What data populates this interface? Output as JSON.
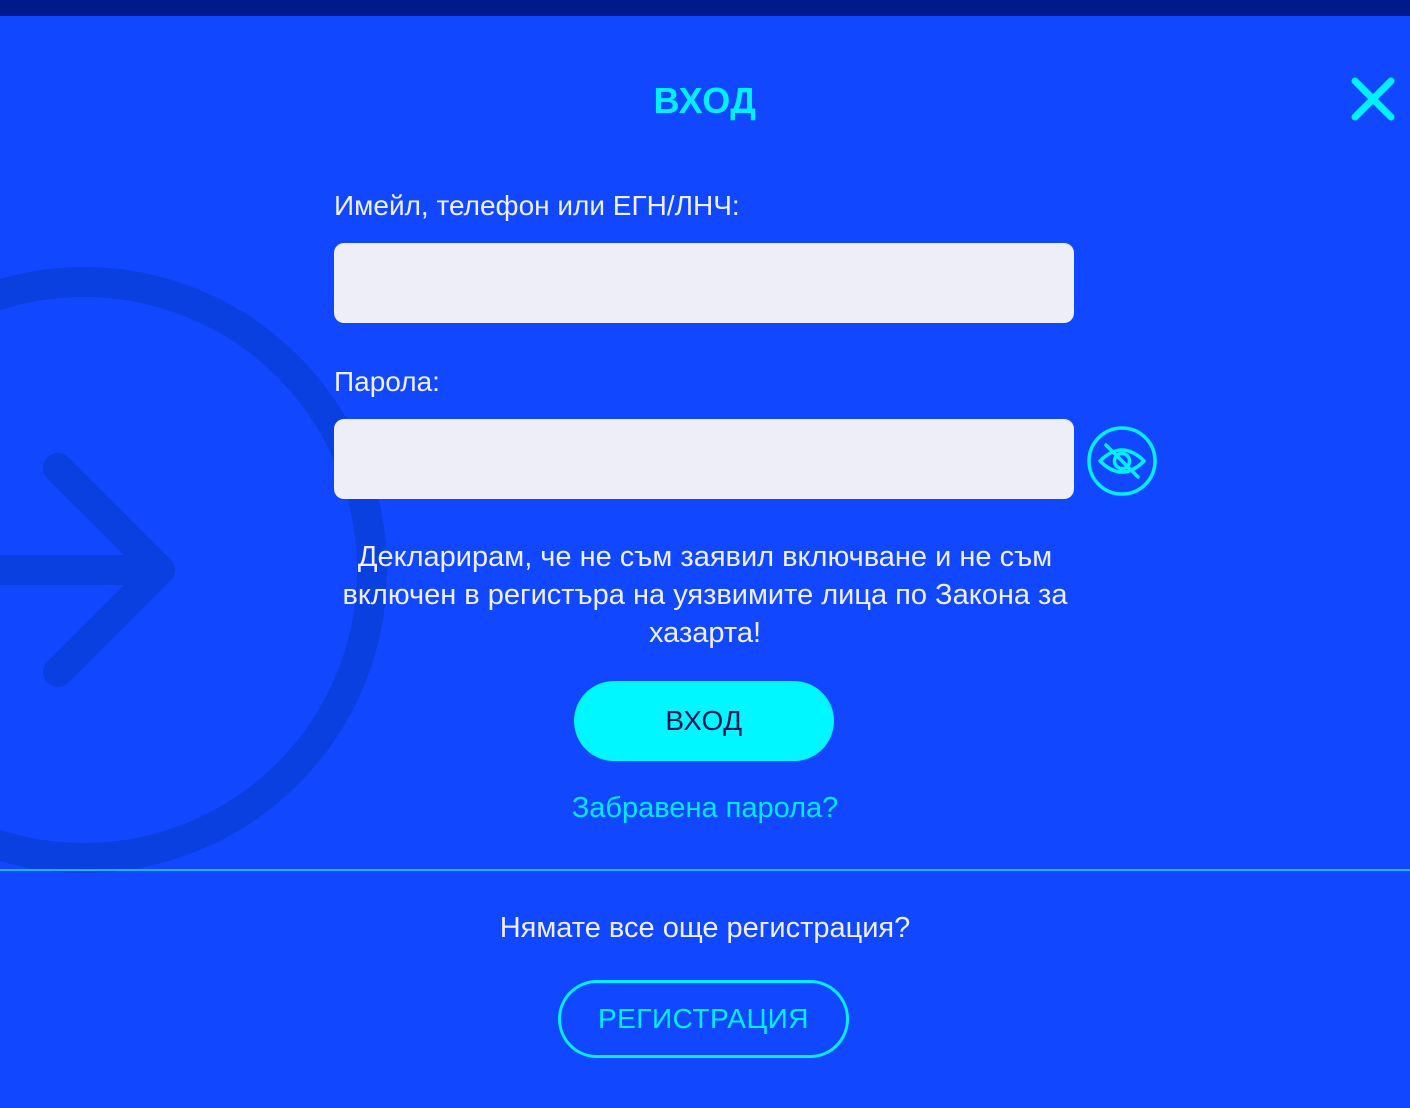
{
  "modal": {
    "title": "ВХОД"
  },
  "form": {
    "login_label": "Имейл, телефон или ЕГН/ЛНЧ:",
    "login_value": "",
    "password_label": "Парола:",
    "password_value": "",
    "declaration": "Декларирам, че не съм заявил включване и не съм включен в регистъра на уязвимите лица по Закона за хазарта!",
    "submit_label": "ВХОД",
    "forgot_password": "Забравена парола?"
  },
  "footer": {
    "no_account_text": "Нямате все още регистрация?",
    "register_label": "РЕГИСТРАЦИЯ"
  },
  "icons": {
    "close": "close-icon",
    "password_toggle": "eye-slash-icon",
    "background": "login-arrow-circle-icon"
  },
  "colors": {
    "background": "#1148ff",
    "top_bar": "#001a8c",
    "accent": "#00f0ff",
    "input_background": "#edeef8",
    "divider": "#18b6ff"
  }
}
